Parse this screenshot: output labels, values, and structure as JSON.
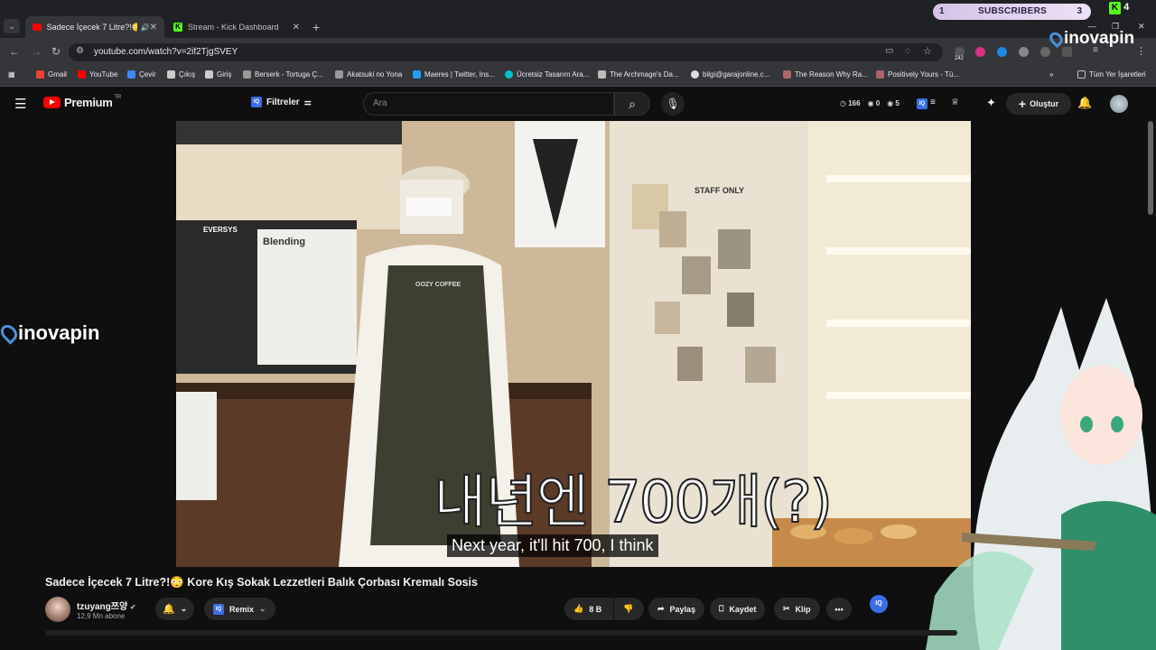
{
  "browser": {
    "tabs": [
      {
        "label": "Sadece İçecek 7 Litre?!😳 K",
        "active": true
      },
      {
        "label": "Stream - Kick Dashboard",
        "active": false
      }
    ],
    "url": "youtube.com/watch?v=2if2TjgSVEY",
    "bookmarks": [
      "Gmail",
      "YouTube",
      "Çevir",
      "Çıkış",
      "Giriş",
      "Berserk - Tortuga Ç...",
      "Akatsuki no Yona",
      "Maeres | Twitter, Ins...",
      "Ücretsiz Tasarım Ara...",
      "The Archmage's Da...",
      "bilgi@garajonline.c...",
      "The Reason Why Ra...",
      "Positively Yours - Tü..."
    ],
    "all_bookmarks": "Tüm Yer İşaretleri",
    "ext_count": "242"
  },
  "overlay": {
    "subs_left": "1",
    "subs_label": "SUBSCRIBERS",
    "subs_right": "3",
    "kick_count": "4",
    "watermark": "inovapin"
  },
  "youtube": {
    "brand": "Premium",
    "region": "TR",
    "filters": "Filtreler",
    "search_placeholder": "Ara",
    "stats": {
      "a": "166",
      "b": "0",
      "c": "5"
    },
    "create": "Oluştur",
    "video": {
      "caption_korean": "내년엔 700개(?)",
      "subtitle": "Next year, it'll hit 700, I think",
      "blending_sign": "Blending",
      "apron": "OOZY COFFEE",
      "staff_sign": "STAFF ONLY",
      "eversys": "EVERSYS"
    },
    "title": "Sadece İçecek 7 Litre?!😳 Kore Kış Sokak Lezzetleri Balık Çorbası Kremalı Sosis",
    "channel": "tzuyang쯔양",
    "subscribers": "12,9 Mn abone",
    "remix": "Remix",
    "likes": "8 B",
    "share": "Paylaş",
    "save": "Kaydet",
    "clip": "Klip",
    "iq": "IQ"
  }
}
